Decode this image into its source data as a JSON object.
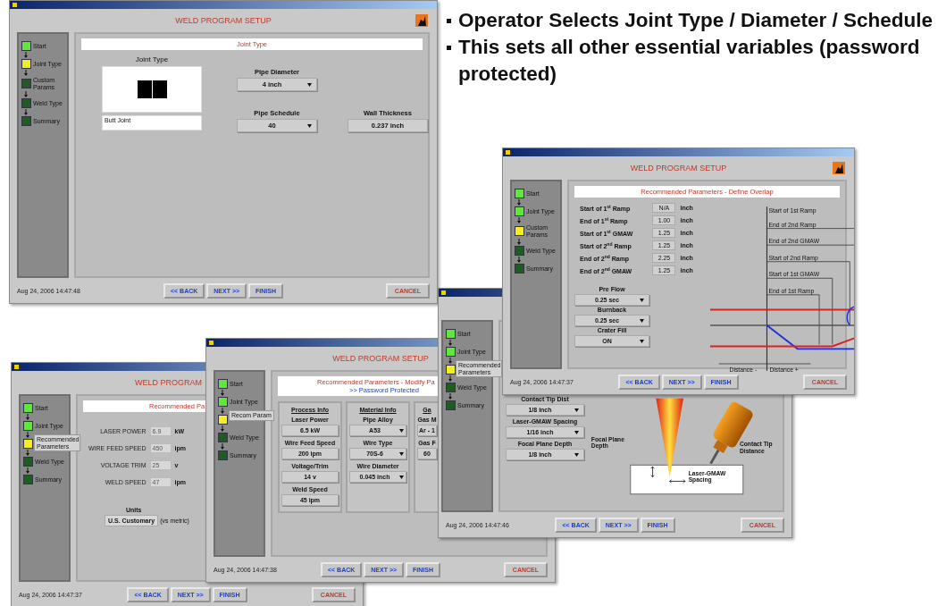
{
  "slide": {
    "bullets": [
      "Operator Selects Joint Type / Diameter / Schedule",
      "This sets all other essential variables (password protected)"
    ]
  },
  "windows": [
    {
      "kind": "joint_type",
      "heading": "WELD PROGRAM SETUP",
      "app_icon": true,
      "steps": [
        {
          "label": "Start",
          "completed": true,
          "current": false,
          "popup": false
        },
        {
          "label": "Joint Type",
          "completed": false,
          "current": true,
          "popup": false
        },
        {
          "label": "Custom Params",
          "completed": false,
          "current": false,
          "popup": false
        },
        {
          "label": "Weld Type",
          "completed": false,
          "current": false,
          "popup": false
        },
        {
          "label": "Summary",
          "completed": false,
          "current": false,
          "popup": false
        }
      ],
      "banner": [
        {
          "text": "Joint Type",
          "kind": "title"
        }
      ],
      "joint_label": "Joint Type",
      "joint_name": "Butt Joint",
      "controls": [
        {
          "label": "Pipe Diameter",
          "value": "4 inch",
          "kind": "dropdown"
        },
        {
          "label": "Pipe Schedule",
          "value": "40",
          "kind": "dropdown"
        },
        {
          "label": "Wall Thickness",
          "value": "0.237 inch",
          "kind": "readout"
        }
      ],
      "date": "Aug 24, 2006 14:47:48",
      "nav_buttons": [
        "<< BACK",
        "NEXT >>",
        "FINISH"
      ],
      "cancel": "CANCEL"
    },
    {
      "kind": "parameters",
      "heading": "WELD PROGRAM",
      "steps": [
        {
          "label": "Start",
          "completed": true,
          "current": false,
          "popup": false
        },
        {
          "label": "Joint Type",
          "completed": true,
          "current": false,
          "popup": false
        },
        {
          "label": "Recommended Parameters",
          "completed": false,
          "current": true,
          "popup": true
        },
        {
          "label": "Weld Type",
          "completed": false,
          "current": false,
          "popup": false
        },
        {
          "label": "Summary",
          "completed": false,
          "current": false,
          "popup": false
        }
      ],
      "banner": [
        {
          "text": "Recommended Pa",
          "kind": "title"
        }
      ],
      "rows": [
        {
          "label": "LASER POWER",
          "value": "6.9",
          "unit": "kW"
        },
        {
          "label": "WIRE FEED SPEED",
          "value": "450",
          "unit": "ipm"
        },
        {
          "label": "VOLTAGE TRIM",
          "value": "25",
          "unit": "v"
        },
        {
          "label": "WELD SPEED",
          "value": "47",
          "unit": "ipm"
        }
      ],
      "units": {
        "label": "Units",
        "value": "U.S. Customary",
        "note": "(vs metric)"
      },
      "date": "Aug 24, 2006 14:47:37",
      "nav_buttons": [
        "<< BACK",
        "NEXT >>",
        "FINISH"
      ],
      "cancel": "CANCEL"
    },
    {
      "kind": "modify",
      "heading": "WELD PROGRAM SETUP",
      "steps": [
        {
          "label": "Start",
          "completed": true,
          "current": false,
          "popup": false
        },
        {
          "label": "Joint Type",
          "completed": true,
          "current": false,
          "popup": false
        },
        {
          "label": "Recom Param",
          "completed": false,
          "current": true,
          "popup": true
        },
        {
          "label": "Weld Type",
          "completed": false,
          "current": false,
          "popup": false
        },
        {
          "label": "Summary",
          "completed": false,
          "current": false,
          "popup": false
        }
      ],
      "banner": [
        {
          "text": "Recommended Parameters - Modify Pa",
          "kind": "title"
        },
        {
          "text": ">> Password Protected",
          "kind": "note"
        }
      ],
      "groups": [
        {
          "title": "Process Info",
          "controls": [
            {
              "label": "Laser Power",
              "value": "6.5 kW",
              "kind": "readout"
            },
            {
              "label": "Wire Feed Speed",
              "value": "200 ipm",
              "kind": "readout"
            },
            {
              "label": "Voltage/Trim",
              "value": "14 v",
              "kind": "readout"
            },
            {
              "label": "Weld Speed",
              "value": "45 ipm",
              "kind": "readout"
            }
          ]
        },
        {
          "title": "Material Info",
          "controls": [
            {
              "label": "Pipe Alloy",
              "value": "A53",
              "kind": "dropdown"
            },
            {
              "label": "Wire Type",
              "value": "70S-6",
              "kind": "dropdown"
            },
            {
              "label": "Wire Diameter",
              "value": "0.045 inch",
              "kind": "dropdown"
            }
          ]
        },
        {
          "title": "Ga",
          "controls": [
            {
              "label": "Gas M",
              "value": "Ar - 1",
              "kind": "readout"
            },
            {
              "label": "Gas F",
              "value": "60",
              "kind": "readout"
            }
          ]
        }
      ],
      "date": "Aug 24, 2006 14:47:38",
      "nav_buttons": [
        "<< BACK",
        "NEXT >>",
        "FINISH"
      ],
      "cancel": "CANCEL"
    },
    {
      "kind": "torch",
      "steps": [
        {
          "label": "Start",
          "completed": true,
          "current": false,
          "popup": false
        },
        {
          "label": "Joint Type",
          "completed": true,
          "current": false,
          "popup": false
        },
        {
          "label": "Recommended Parameters",
          "completed": false,
          "current": true,
          "popup": true
        },
        {
          "label": "Weld Type",
          "completed": false,
          "current": false,
          "popup": false
        },
        {
          "label": "Summary",
          "completed": false,
          "current": false,
          "popup": false
        }
      ],
      "controls": [
        {
          "label": "Contact Tip Dist",
          "value": "1/8 inch",
          "kind": "dropdown"
        },
        {
          "label": "Laser-GMAW Spacing",
          "value": "1/16 inch",
          "kind": "dropdown"
        },
        {
          "label": "Focal Plane Depth",
          "value": "1/8 inch",
          "kind": "dropdown"
        }
      ],
      "drawing_labels": [
        "Focal Plane Depth",
        "Contact Tip Distance",
        "Laser-GMAW Spacing"
      ],
      "date": "Aug 24, 2006 14:47:46",
      "nav_buttons": [
        "<< BACK",
        "NEXT >>",
        "FINISH"
      ],
      "cancel": "CANCEL"
    },
    {
      "kind": "overlap",
      "heading": "WELD PROGRAM SETUP",
      "app_icon": true,
      "steps": [
        {
          "label": "Start",
          "completed": true,
          "current": false,
          "popup": false
        },
        {
          "label": "Joint Type",
          "completed": true,
          "current": false,
          "popup": false
        },
        {
          "label": "Custom Params",
          "completed": false,
          "current": true,
          "popup": false
        },
        {
          "label": "Weld Type",
          "completed": false,
          "current": false,
          "popup": false
        },
        {
          "label": "Summary",
          "completed": false,
          "current": false,
          "popup": false
        }
      ],
      "banner": [
        {
          "text": "Recommended Parameters - Define Overlap",
          "kind": "title"
        }
      ],
      "rows": [
        {
          "label": "Start of 1$^{st}$ Ramp",
          "value": "N/A",
          "unit": "inch"
        },
        {
          "label": "End of 1$^{st}$ Ramp",
          "value": "1.00",
          "unit": "inch"
        },
        {
          "label": "Start of 1$^{st}$ GMAW",
          "value": "1.25",
          "unit": "inch"
        },
        {
          "label": "Start of 2$^{nd}$ Ramp",
          "value": "1.25",
          "unit": "inch"
        },
        {
          "label": "End of 2$^{nd}$ Ramp",
          "value": "2.25",
          "unit": "inch"
        },
        {
          "label": "End of 2$^{nd}$ GMAW",
          "value": "1.25",
          "unit": "inch"
        }
      ],
      "controls": [
        {
          "label": "Pre Flow",
          "value": "0.25 sec",
          "kind": "dropdown"
        },
        {
          "label": "Burnback",
          "value": "0.25 sec",
          "kind": "dropdown"
        },
        {
          "label": "Crater Fill",
          "value": "ON",
          "kind": "dropdown"
        }
      ],
      "diagram_labels": [
        "Start of 1st Ramp",
        "End of 2nd Ramp",
        "End of 2nd GMAW",
        "Start of 2nd Ramp",
        "Start of 1st GMAW",
        "End of 1st Ramp",
        "Distance -",
        "Distance +"
      ],
      "date": "Aug 24, 2006 14:47:37",
      "nav_buttons": [
        "<< BACK",
        "NEXT >>",
        "FINISH"
      ],
      "cancel": "CANCEL"
    }
  ]
}
